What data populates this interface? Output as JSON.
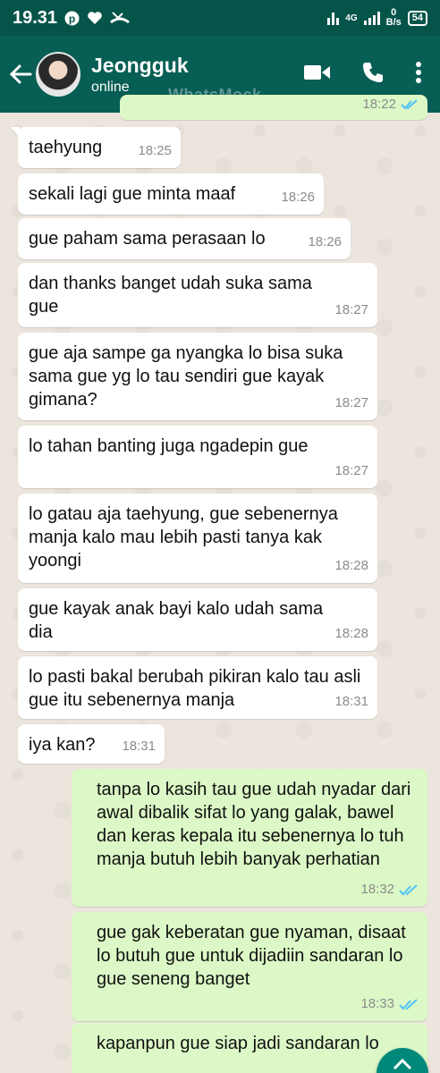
{
  "status_bar": {
    "time": "19.31",
    "network_label": "4G",
    "speed_value": "0",
    "speed_unit": "B/s",
    "battery": "54"
  },
  "header": {
    "contact_name": "Jeongguk",
    "contact_status": "online",
    "watermark": "WhatsMock"
  },
  "messages": [
    {
      "dir": "out",
      "text": "",
      "time": "18:22",
      "ticks": "read"
    },
    {
      "dir": "in",
      "text": "taehyung",
      "time": "18:25"
    },
    {
      "dir": "in",
      "text": "sekali lagi gue minta maaf",
      "time": "18:26"
    },
    {
      "dir": "in",
      "text": "gue paham sama perasaan lo",
      "time": "18:26"
    },
    {
      "dir": "in",
      "text": "dan thanks banget udah suka sama gue",
      "time": "18:27"
    },
    {
      "dir": "in",
      "text": "gue aja sampe ga nyangka lo bisa suka sama gue yg lo tau sendiri gue kayak gimana?",
      "time": "18:27"
    },
    {
      "dir": "in",
      "text": "lo tahan banting juga ngadepin gue",
      "time": "18:27"
    },
    {
      "dir": "in",
      "text": "lo gatau aja taehyung, gue sebenernya manja kalo mau lebih pasti tanya kak yoongi",
      "time": "18:28"
    },
    {
      "dir": "in",
      "text": "gue kayak anak bayi kalo udah sama dia",
      "time": "18:28"
    },
    {
      "dir": "in",
      "text": "lo pasti bakal berubah pikiran kalo tau asli gue itu sebenernya manja",
      "time": "18:31"
    },
    {
      "dir": "in",
      "text": "iya kan?",
      "time": "18:31"
    },
    {
      "dir": "out",
      "text": "tanpa lo kasih tau gue udah nyadar dari awal dibalik sifat lo yang galak, bawel dan keras kepala itu sebenernya lo tuh manja butuh lebih banyak perhatian",
      "time": "18:32",
      "ticks": "read"
    },
    {
      "dir": "out",
      "text": "gue gak keberatan gue nyaman, disaat lo butuh gue untuk dijadiin sandaran lo gue seneng banget",
      "time": "18:33",
      "ticks": "read"
    },
    {
      "dir": "out",
      "text": "kapanpun gue siap jadi sandaran lo",
      "time": "",
      "ticks": "read"
    }
  ],
  "colors": {
    "header": "#075e54",
    "status_bar": "#05544a",
    "incoming_bubble": "#ffffff",
    "outgoing_bubble": "#dcf8c6",
    "read_ticks": "#4fc3f7",
    "fab": "#00897b"
  },
  "icons": [
    "back-arrow-icon",
    "video-call-icon",
    "phone-icon",
    "more-options-icon",
    "pinterest-icon",
    "heart-icon",
    "missed-call-icon",
    "double-check-icon"
  ]
}
